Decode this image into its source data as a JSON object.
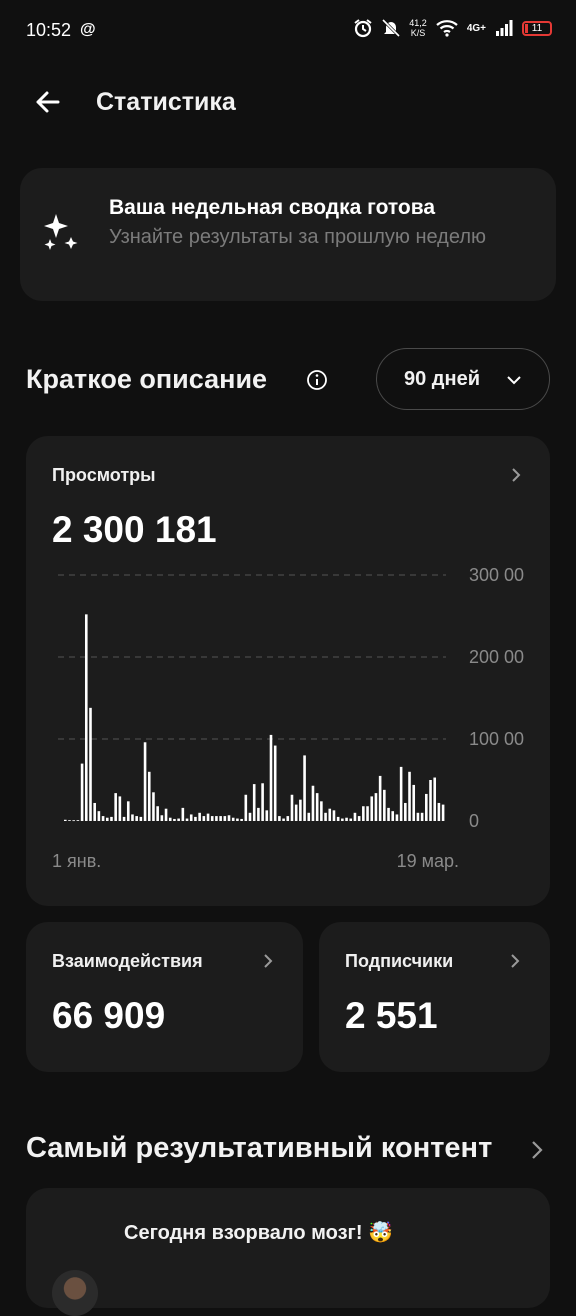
{
  "status_bar": {
    "time": "10:52",
    "threads_glyph": "@",
    "speed_value": "41,2",
    "speed_unit": "K/S",
    "network": "4G+",
    "battery": "11",
    "icons": [
      "alarm-icon",
      "mute-icon",
      "wifi-icon",
      "signal-icon",
      "battery-icon"
    ]
  },
  "header": {
    "title": "Статистика"
  },
  "banner": {
    "title": "Ваша недельная сводка готова",
    "subtitle": "Узнайте результаты за прошлую неделю"
  },
  "summary": {
    "title": "Краткое описание",
    "period": "90 дней"
  },
  "views": {
    "label": "Просмотры",
    "value": "2 300 181"
  },
  "interactions": {
    "label": "Взаимодействия",
    "value": "66 909"
  },
  "followers": {
    "label": "Подписчики",
    "value": "2 551"
  },
  "top_content": {
    "title": "Самый результативный контент",
    "post_text": "Сегодня взорвало мозг! 🤯"
  },
  "colors": {
    "background": "#101010",
    "card": "#1c1c1c",
    "accent_text": "#ffffff",
    "muted_text": "#7b7b7b",
    "battery_low": "#e53935"
  },
  "chart_data": {
    "type": "bar",
    "x_start_label": "1 янв.",
    "x_end_label": "19 мар.",
    "y_tick_labels": [
      "300 00",
      "200 00",
      "100 00",
      "0"
    ],
    "y_ticks": [
      300000,
      200000,
      100000,
      0
    ],
    "ylim": [
      0,
      300000
    ],
    "grid": true,
    "values": [
      1500,
      1000,
      900,
      1000,
      70000,
      252000,
      138000,
      22000,
      12000,
      6000,
      4000,
      5000,
      34000,
      30000,
      5000,
      24000,
      8000,
      6000,
      5000,
      96000,
      60000,
      35000,
      18000,
      7000,
      15000,
      4000,
      2500,
      3000,
      16000,
      3000,
      8000,
      5000,
      10000,
      6000,
      9000,
      6000,
      6000,
      6000,
      6000,
      7000,
      4000,
      3000,
      2500,
      32000,
      10000,
      45000,
      16000,
      46000,
      13000,
      105000,
      92000,
      6000,
      3000,
      6000,
      32000,
      20000,
      26000,
      80000,
      10000,
      43000,
      34000,
      24000,
      10000,
      15000,
      13000,
      5000,
      3000,
      4000,
      3000,
      10000,
      6000,
      18000,
      18000,
      30000,
      34000,
      55000,
      38000,
      16000,
      12000,
      8000,
      66000,
      22000,
      60000,
      44000,
      10000,
      10000,
      33000,
      50000,
      53000,
      22000,
      20000
    ]
  }
}
